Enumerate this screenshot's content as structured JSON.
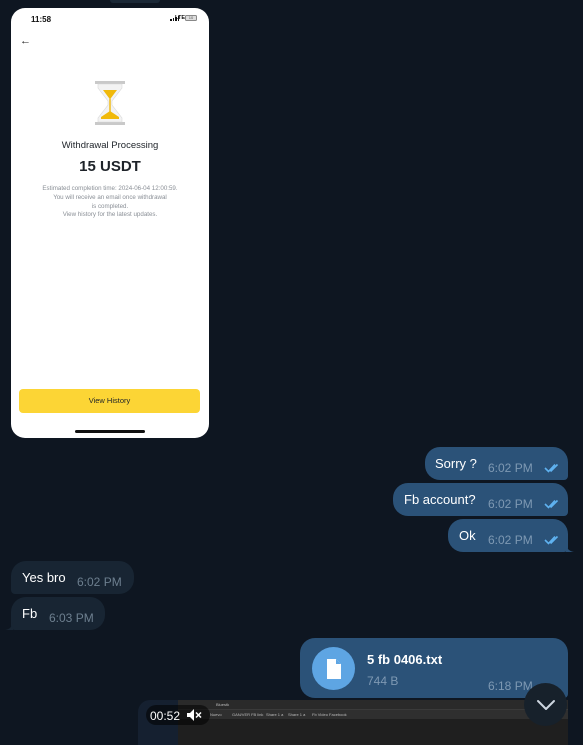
{
  "phone_screenshot": {
    "status_time": "11:58",
    "status_network": "LTE",
    "battery": "10",
    "title": "Withdrawal Processing",
    "amount": "15 USDT",
    "note_line1": "Estimated completion time: 2024-06-04 12:00:59.",
    "note_line2": "You will receive an email once withdrawal",
    "note_line3": "is completed.",
    "note_line4": "View history for the latest updates.",
    "button_label": "View History"
  },
  "messages": [
    {
      "direction": "out",
      "text": "Sorry ?",
      "time": "6:02 PM",
      "read": true
    },
    {
      "direction": "out",
      "text": "Fb account?",
      "time": "6:02 PM",
      "read": true
    },
    {
      "direction": "out",
      "text": "Ok",
      "time": "6:02 PM",
      "read": true
    },
    {
      "direction": "in",
      "text": "Yes bro",
      "time": "6:02 PM"
    },
    {
      "direction": "in",
      "text": "Fb",
      "time": "6:03 PM"
    }
  ],
  "file_message": {
    "name": "5 fb 0406.txt",
    "size": "744 B",
    "time": "6:18 PM",
    "icon": "document-icon"
  },
  "video_message": {
    "duration": "00:52",
    "muted": true,
    "tab_title": "Bluestk",
    "bookmarks": [
      "Nuevo",
      "GAN/VER FB link",
      "Share 1 a",
      "Share 1 a",
      "Fb Video Facebook"
    ]
  },
  "colors": {
    "background": "#0e1621",
    "outgoing_bubble": "#2b5278",
    "incoming_bubble": "#182533",
    "read_ticks": "#5fb2f0",
    "accent_button": "#fcd535"
  }
}
